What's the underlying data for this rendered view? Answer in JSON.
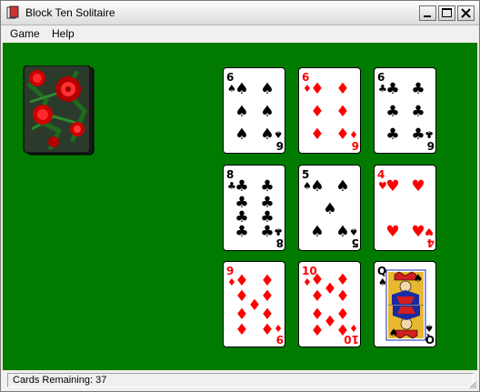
{
  "window": {
    "title": "Block Ten Solitaire"
  },
  "menu": {
    "items": [
      "Game",
      "Help"
    ]
  },
  "status": {
    "text": "Cards Remaining: 37"
  },
  "deck": {
    "back_design": "red-roses"
  },
  "colors": {
    "felt": "#007b00",
    "red_suit": "#ff0000",
    "black_suit": "#000000"
  },
  "cards": [
    {
      "rank": "6",
      "suit": "spades"
    },
    {
      "rank": "6",
      "suit": "diamonds"
    },
    {
      "rank": "6",
      "suit": "clubs"
    },
    {
      "rank": "8",
      "suit": "clubs"
    },
    {
      "rank": "5",
      "suit": "spades"
    },
    {
      "rank": "4",
      "suit": "hearts"
    },
    {
      "rank": "9",
      "suit": "diamonds"
    },
    {
      "rank": "10",
      "suit": "diamonds"
    },
    {
      "rank": "Q",
      "suit": "spades"
    }
  ]
}
